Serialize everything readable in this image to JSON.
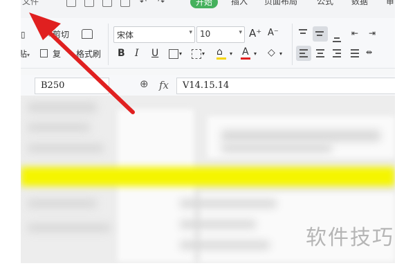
{
  "menu": {
    "items": [
      "文件",
      "开始",
      "插入",
      "页面布局",
      "公式",
      "数据",
      "审"
    ],
    "active": "开始"
  },
  "ribbon": {
    "cut_label": "剪切",
    "copy_label": "复",
    "paste_label": "贴",
    "format_painter_label": "格式刷",
    "font_name": "宋体",
    "font_size": "10",
    "increase_font": "A⁺",
    "decrease_font": "A⁻",
    "bold": "B",
    "italic": "I",
    "underline": "U",
    "font_color_letter": "A",
    "accent_red": "#e02020",
    "highlight_yellow": "#f5d400"
  },
  "formula_bar": {
    "cell_ref": "B250",
    "fx_label": "fx",
    "formula_value": "V14.15.14"
  },
  "sheet": {
    "watermark": "软件技巧",
    "highlight_color": "#f5f500"
  },
  "annotation": {
    "arrow_color": "#e02020"
  }
}
